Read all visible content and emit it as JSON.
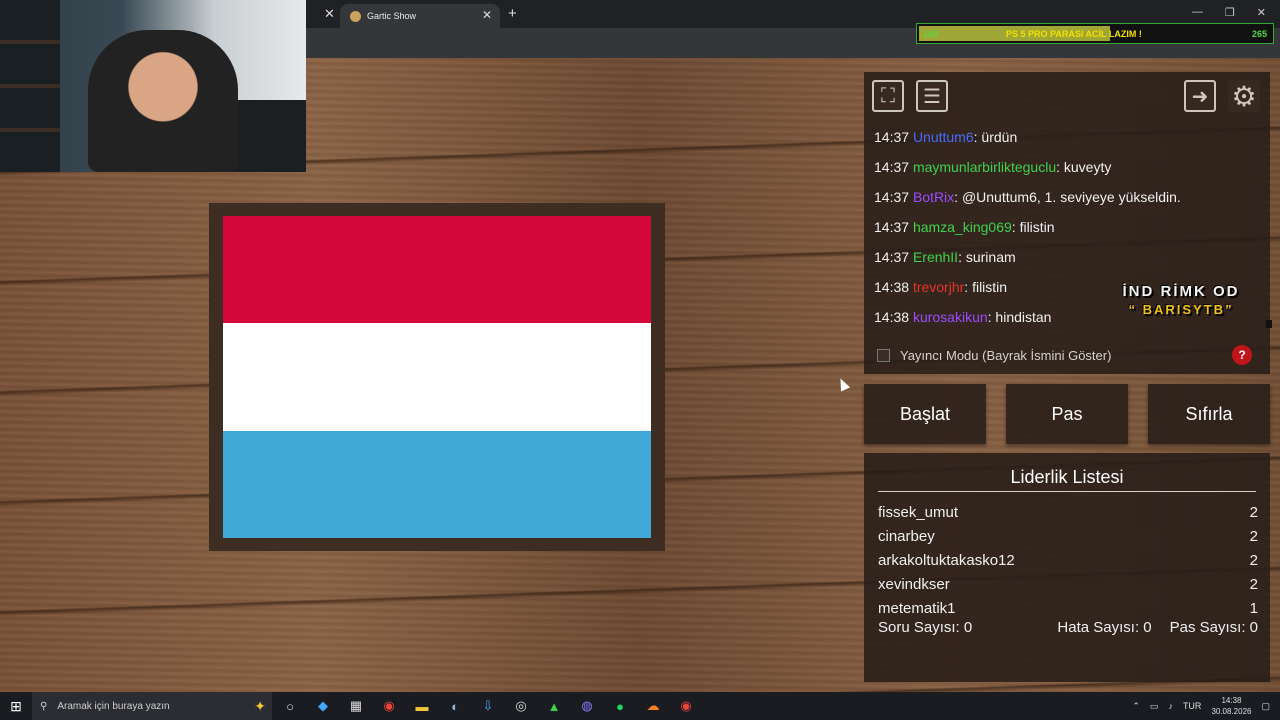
{
  "browser": {
    "tab_title": "Gartic Show",
    "tab_close": "✕",
    "new_tab": "+",
    "minimize": "—",
    "restore": "❐",
    "close": "✕"
  },
  "donation": {
    "left": "143",
    "text": "PS 5 PRO PARASI ACİL LAZIM !",
    "right": "265",
    "progress": 0.54
  },
  "flag": {
    "colors": [
      "#d4083d",
      "#ffffff",
      "#3fa8d7"
    ]
  },
  "chat": [
    {
      "time": "14:37",
      "user": "Unuttum6",
      "color": "#4a6bff",
      "msg": ": ürdün"
    },
    {
      "time": "14:37",
      "user": "maymunlarbirlikteguclu",
      "color": "#3fd24a",
      "msg": ": kuveyty"
    },
    {
      "time": "14:37",
      "user": "BotRix",
      "color": "#9d4cff",
      "msg": ": @Unuttum6, 1. seviyeye yükseldin."
    },
    {
      "time": "14:37",
      "user": "hamza_king069",
      "color": "#3fd24a",
      "msg": ": filistin"
    },
    {
      "time": "14:37",
      "user": "ErenhII",
      "color": "#3fd24a",
      "msg": ": surinam"
    },
    {
      "time": "14:38",
      "user": "trevorjhr",
      "color": "#e8352a",
      "msg": ": filistin"
    },
    {
      "time": "14:38",
      "user": "kurosakikun",
      "color": "#9d4cff",
      "msg": ": hindistan"
    }
  ],
  "overlay": {
    "line1": "İND RİMK OD",
    "line2": "“ BARISYTB”"
  },
  "streamer_mode": {
    "label": "Yayıncı Modu (Bayrak İsmini Göster)",
    "checked": false,
    "help": "?"
  },
  "buttons": {
    "start": "Başlat",
    "pass": "Pas",
    "reset": "Sıfırla"
  },
  "leaderboard": {
    "title": "Liderlik Listesi",
    "rows": [
      {
        "name": "fissek_umut",
        "score": "2"
      },
      {
        "name": "cinarbey",
        "score": "2"
      },
      {
        "name": "arkakoltuktakasko12",
        "score": "2"
      },
      {
        "name": "xevindkser",
        "score": "2"
      },
      {
        "name": "metematik1",
        "score": "1"
      }
    ],
    "question_count": "Soru Sayısı: 0",
    "error_count": "Hata Sayısı: 0",
    "pass_count": "Pas Sayısı: 0"
  },
  "icons": {
    "fullscreen": "fullscreen-icon",
    "list": "list-icon",
    "exit": "exit-icon",
    "settings": "gear-icon"
  },
  "taskbar": {
    "search_placeholder": "Aramak için buraya yazın",
    "lang": "TUR",
    "time": "14:38",
    "date": "30.08.2026"
  }
}
